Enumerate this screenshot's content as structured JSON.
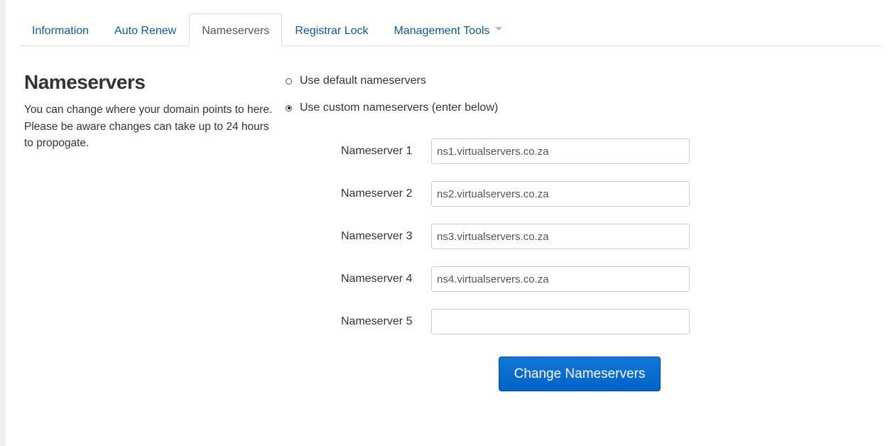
{
  "tabs": [
    {
      "label": "Information",
      "active": false
    },
    {
      "label": "Auto Renew",
      "active": false
    },
    {
      "label": "Nameservers",
      "active": true
    },
    {
      "label": "Registrar Lock",
      "active": false
    },
    {
      "label": "Management Tools",
      "active": false,
      "dropdown": true
    }
  ],
  "section": {
    "title": "Nameservers",
    "description": "You can change where your domain points to here. Please be aware changes can take up to 24 hours to propogate."
  },
  "options": {
    "default_label": "Use default nameservers",
    "custom_label": "Use custom nameservers (enter below)",
    "selected": "custom"
  },
  "nameservers": [
    {
      "label": "Nameserver 1",
      "value": "ns1.virtualservers.co.za"
    },
    {
      "label": "Nameserver 2",
      "value": "ns2.virtualservers.co.za"
    },
    {
      "label": "Nameserver 3",
      "value": "ns3.virtualservers.co.za"
    },
    {
      "label": "Nameserver 4",
      "value": "ns4.virtualservers.co.za"
    },
    {
      "label": "Nameserver 5",
      "value": ""
    }
  ],
  "submit_label": "Change Nameservers",
  "colors": {
    "link": "#0a5a96",
    "button": "#0063c6"
  }
}
